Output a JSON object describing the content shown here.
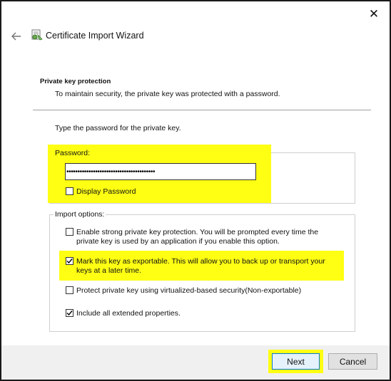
{
  "window": {
    "title": "Certificate Import Wizard",
    "close_icon": "close-icon",
    "back_icon": "back-arrow-icon",
    "title_icon": "certificate-wizard-icon"
  },
  "section": {
    "heading": "Private key protection",
    "description": "To maintain security, the private key was protected with a password."
  },
  "password_section": {
    "instruction": "Type the password for the private key.",
    "label": "Password:",
    "value": "••••••••••••••••••••••••••••••••••••••••",
    "display_password": {
      "label": "Display Password",
      "checked": false
    }
  },
  "import_options": {
    "label": "Import options:",
    "options": [
      {
        "line1": "Enable strong private key protection. You will be prompted every time the",
        "line2": "private key is used by an application if you enable this option.",
        "checked": false
      },
      {
        "line1": "Mark this key as exportable. This will allow you to back up or transport your",
        "line2": "keys at a later time.",
        "checked": true
      },
      {
        "line1": "Protect private key using virtualized-based security(Non-exportable)",
        "checked": false
      },
      {
        "line1": "Include all extended properties.",
        "checked": true
      }
    ]
  },
  "footer": {
    "next_label": "Next",
    "cancel_label": "Cancel"
  },
  "colors": {
    "highlight": "#ffff14",
    "primary_button_border": "#0078d7"
  }
}
